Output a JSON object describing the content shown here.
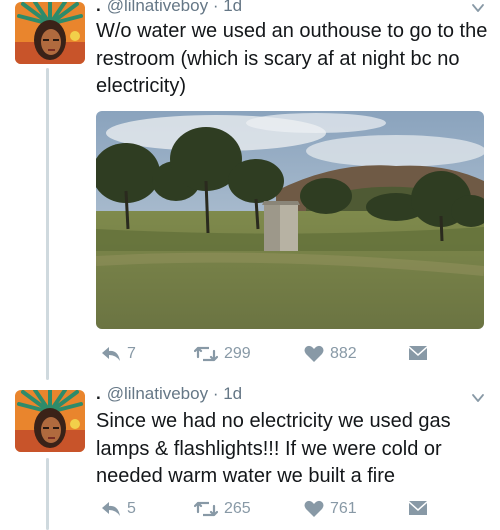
{
  "tweets": [
    {
      "handle": "@lilnativeboy · 1d",
      "text": "W/o water we used an outhouse to go to the restroom (which is scary af at night bc no electricity)",
      "reply_count": "7",
      "retweet_count": "299",
      "like_count": "882"
    },
    {
      "handle": "@lilnativeboy · 1d",
      "text": "Since we had no electricity we used gas lamps & flashlights!!! If we were cold or needed warm water we built a fire",
      "reply_count": "5",
      "retweet_count": "265",
      "like_count": "761"
    }
  ],
  "icons": {
    "reply": "reply-icon",
    "retweet": "retweet-icon",
    "like": "heart-icon",
    "dm": "direct-message-icon",
    "more": "chevron-down-icon"
  },
  "colors": {
    "text": "#14171a",
    "muted": "#8899a6",
    "handle": "#657786",
    "thread_line": "#cfd9de"
  }
}
